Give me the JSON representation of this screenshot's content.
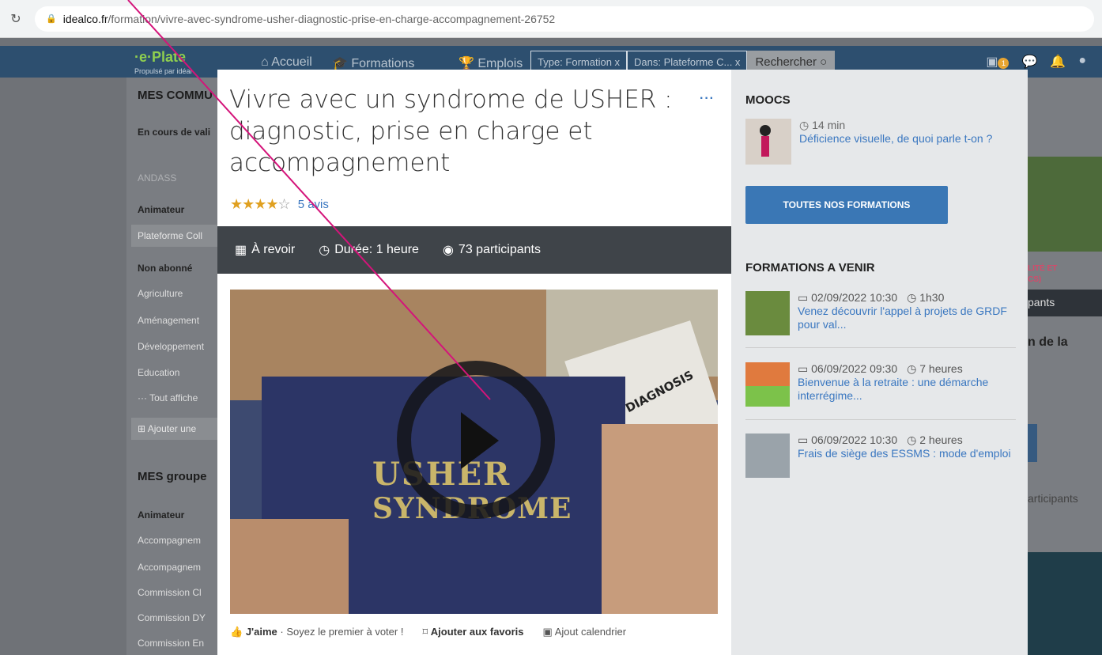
{
  "browser": {
    "reload_icon": "reload-icon",
    "url_host": "idealco.fr",
    "url_path": "/formation/vivre-avec-syndrome-usher-diagnostic-prise-en-charge-accompagnement-26752"
  },
  "navbar": {
    "logo_mark": "·e·Plate",
    "logo_sub": "Propulsé par idéal",
    "links": [
      "Accueil",
      "Formations",
      "Emplois"
    ],
    "chip_type": "Type: Formation  x",
    "chip_in": "Dans: Plateforme C...  x",
    "search_label": "Rechercher",
    "notif_count": "1"
  },
  "sidebar": {
    "heading1": "MES COMMU",
    "validation": "En cours de vali",
    "andass": "ANDASS",
    "animateur": "Animateur",
    "plateforme": "Plateforme Coll",
    "non_abonne": "Non abonné",
    "items": [
      "Agriculture",
      "Aménagement",
      "Développement",
      "Education"
    ],
    "show_all": "··· Tout affiche",
    "add": "Ajouter une",
    "heading2": "MES groupe",
    "animateur2": "Animateur",
    "groups": [
      "Accompagnem",
      "Accompagnem",
      "Commission Cl",
      "Commission DY",
      "Commission En"
    ]
  },
  "right_bg": {
    "text1": "LITÉ ET",
    "text2": "CS)",
    "text3": "pants",
    "text4": "n de la",
    "text5": "articipants"
  },
  "modal": {
    "title": "Vivre avec un syndrome de USHER : diagnostic, prise en charge et accompagnement",
    "more": "···",
    "rating": 4,
    "reviews": "5 avis",
    "meta": {
      "replay": "À revoir",
      "duration": "Durée: 1 heure",
      "participants": "73 participants"
    },
    "video": {
      "cover_line1": "USHER",
      "cover_line2": "SYNDROME",
      "cover_label": "DIAGNOSIS"
    },
    "actions": {
      "like": "J'aime",
      "like_note": "· Soyez le premier à voter !",
      "favorite": "Ajouter aux favoris",
      "calendar": "Ajout calendrier"
    }
  },
  "side": {
    "moocs_heading": "MOOCS",
    "mooc": {
      "duration": "14 min",
      "title": "Déficience visuelle, de quoi parle t-on ?"
    },
    "cta": "TOUTES NOS FORMATIONS",
    "upcoming_heading": "FORMATIONS A VENIR",
    "events": [
      {
        "date": "02/09/2022 10:30",
        "duration": "1h30",
        "title": "Venez découvrir l'appel à projets de GRDF pour val..."
      },
      {
        "date": "06/09/2022 09:30",
        "duration": "7 heures",
        "title": "Bienvenue à la retraite : une démarche interrégime..."
      },
      {
        "date": "06/09/2022 10:30",
        "duration": "2 heures",
        "title": "Frais de siège des ESSMS : mode d'emploi"
      }
    ]
  },
  "colors": {
    "accent": "#3a77c0",
    "meta_bar": "#3f4449",
    "cta": "#3a77b5",
    "annotation": "#d4147a"
  }
}
